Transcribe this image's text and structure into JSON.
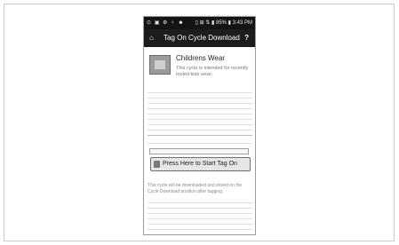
{
  "status_bar": {
    "left_icons": "⊙ ▣ ⚙ ♀ ☻",
    "right_text": "▯ ⊞ ⇅ ▮ 85% ▮ 3:43 PM"
  },
  "app_bar": {
    "home_icon": "home-icon",
    "title": "Tag On Cycle Download",
    "help_label": "?"
  },
  "cycle": {
    "title": "Childrens Wear",
    "description": "This cycle is intended for recently tooled kids wear."
  },
  "start_button": {
    "label": "Press Here to Start Tag On"
  },
  "help_text": "This cycle will be downloaded and stored on the Cycle Download position after tagging."
}
